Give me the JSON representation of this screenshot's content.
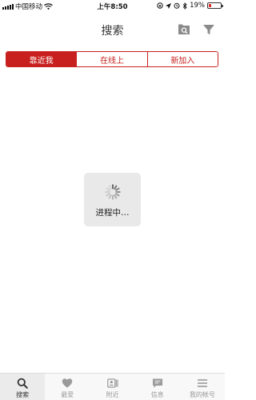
{
  "status_bar": {
    "carrier": "中国移动",
    "time": "上午8:50",
    "battery_percent": "19%",
    "battery_level": 0.19
  },
  "nav": {
    "title": "搜索",
    "icons": [
      "search-folder-icon",
      "filter-icon"
    ]
  },
  "segments": [
    {
      "label": "靠近我",
      "selected": true
    },
    {
      "label": "在线上",
      "selected": false
    },
    {
      "label": "新加入",
      "selected": false
    }
  ],
  "loading": {
    "text": "进程中…"
  },
  "tabs": [
    {
      "label": "搜索",
      "icon": "search-icon",
      "selected": true
    },
    {
      "label": "最爱",
      "icon": "heart-icon",
      "selected": false
    },
    {
      "label": "附近",
      "icon": "contact-card-icon",
      "selected": false
    },
    {
      "label": "信息",
      "icon": "message-icon",
      "selected": false
    },
    {
      "label": "我的帐号",
      "icon": "menu-icon",
      "selected": false
    }
  ],
  "colors": {
    "accent": "#c8201e",
    "battery_low": "#e02020",
    "tab_inactive": "#9a9a9a"
  }
}
